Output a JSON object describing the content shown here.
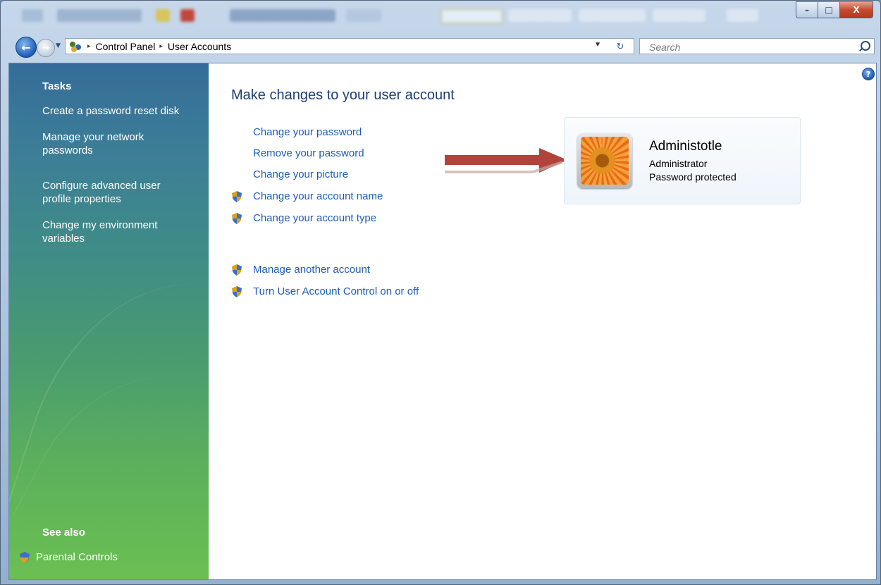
{
  "window": {
    "caption_buttons": {
      "minimize": "–",
      "maximize": "□",
      "close": "X"
    }
  },
  "nav": {
    "back_glyph": "←",
    "forward_glyph": "→",
    "recent_glyph": "▼",
    "breadcrumb": [
      "Control Panel",
      "User Accounts"
    ],
    "breadcrumb_separator": "▸",
    "address_dropdown_glyph": "▼",
    "refresh_glyph": "↻",
    "search_placeholder": "Search"
  },
  "sidebar": {
    "tasks_heading": "Tasks",
    "tasks": [
      "Create a password reset disk",
      "Manage your network passwords",
      "Configure advanced user profile properties",
      "Change my environment variables"
    ],
    "see_also_heading": "See also",
    "see_also": [
      "Parental Controls"
    ]
  },
  "main": {
    "help_glyph": "?",
    "title": "Make changes to your user account",
    "links": [
      "Change your password",
      "Remove your password",
      "Change your picture",
      "Change your account name",
      "Change your account type"
    ],
    "other_links": [
      "Manage another account",
      "Turn User Account Control on or off"
    ]
  },
  "account": {
    "name": "Administotle",
    "type": "Administrator",
    "status": "Password protected",
    "picture": "orange-flower-picture"
  },
  "colors": {
    "link": "#1c5cb6",
    "title": "#1e3d78",
    "arrow": "#b0443c",
    "sidebar_top": "#356c9a",
    "sidebar_bottom": "#6bbf52"
  }
}
